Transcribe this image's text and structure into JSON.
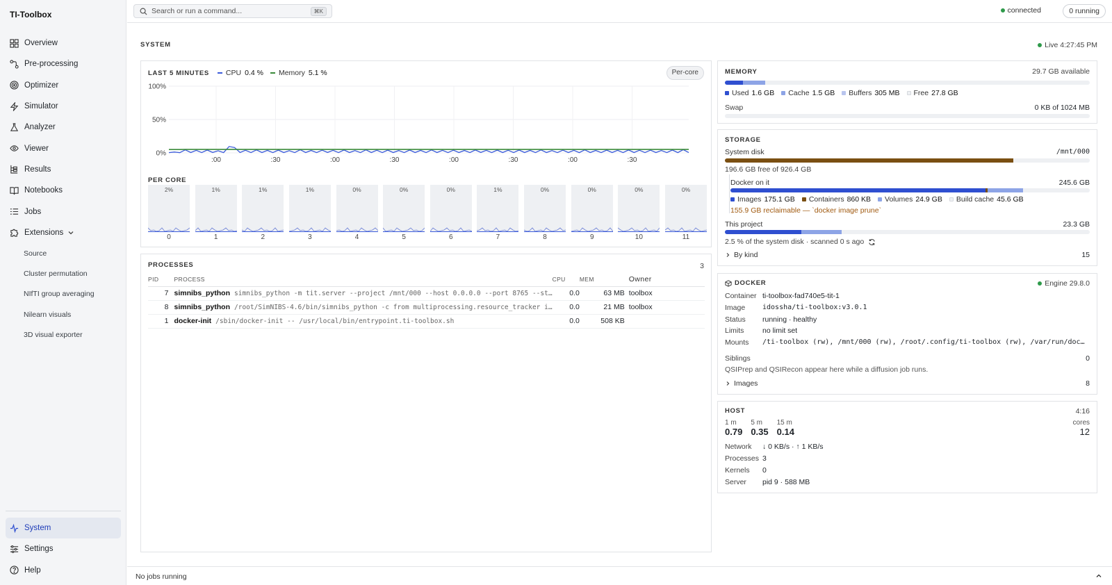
{
  "app": {
    "title": "TI-Toolbox"
  },
  "sidebar": {
    "items": [
      {
        "label": "Overview",
        "icon": "grid-icon"
      },
      {
        "label": "Pre-processing",
        "icon": "workflow-icon"
      },
      {
        "label": "Optimizer",
        "icon": "target-icon"
      },
      {
        "label": "Simulator",
        "icon": "bolt-icon"
      },
      {
        "label": "Analyzer",
        "icon": "flask-icon"
      },
      {
        "label": "Viewer",
        "icon": "eye-icon"
      },
      {
        "label": "Results",
        "icon": "tree-icon"
      },
      {
        "label": "Notebooks",
        "icon": "book-icon"
      },
      {
        "label": "Jobs",
        "icon": "list-icon"
      },
      {
        "label": "Extensions",
        "icon": "puzzle-icon"
      }
    ],
    "extensions": [
      "Source",
      "Cluster permutation",
      "NIfTI group averaging",
      "Nilearn visuals",
      "3D visual exporter"
    ],
    "bottom": [
      {
        "label": "System",
        "icon": "activity-icon",
        "active": true
      },
      {
        "label": "Settings",
        "icon": "sliders-icon"
      },
      {
        "label": "Help",
        "icon": "help-icon"
      }
    ]
  },
  "topbar": {
    "search_placeholder": "Search or run a command...",
    "shortcut": "⌘K",
    "connection": "connected",
    "running": "0 running"
  },
  "main": {
    "section": "SYSTEM",
    "live": "Live 4:27:45 PM"
  },
  "chart": {
    "title": "LAST 5 MINUTES",
    "cpu_label": "CPU",
    "cpu_value": "0.4 %",
    "mem_label": "Memory",
    "mem_value": "5.1 %",
    "percore_button": "Per-core",
    "percore_title": "PER CORE"
  },
  "chart_data": {
    "type": "line",
    "y_ticks": [
      "100%",
      "50%",
      "0%"
    ],
    "x_ticks": [
      ":00",
      ":30",
      ":00",
      ":30",
      ":00",
      ":30",
      ":00",
      ":30"
    ],
    "ylim": [
      0,
      100
    ],
    "series": [
      {
        "name": "CPU",
        "color": "#3b5bdb",
        "values": [
          0.4,
          1.2,
          0.3,
          4.5,
          0.5,
          3.8,
          0.4,
          4.2,
          0.6,
          3.1,
          0.4,
          9.5,
          8.0,
          0.5,
          3.9,
          0.4,
          4.4,
          0.5,
          3.6,
          0.4,
          4.1,
          0.5,
          3.2,
          0.4,
          4.6,
          0.5,
          3.5,
          0.4,
          4.0,
          0.6,
          3.7,
          0.4,
          4.3,
          0.5,
          3.3,
          0.4,
          4.5,
          0.5,
          3.9,
          0.4,
          4.1,
          0.5,
          3.4,
          0.4,
          4.2,
          0.5,
          3.6,
          0.4,
          4.4,
          0.5,
          3.8,
          0.4,
          4.0,
          0.5,
          3.5,
          0.4,
          4.3,
          0.6,
          3.7,
          0.4,
          4.1,
          0.5,
          3.9,
          0.4,
          4.2,
          0.5,
          3.6,
          0.4,
          4.4,
          0.5,
          3.3,
          0.4,
          4.0,
          0.5,
          3.8,
          0.4,
          4.5,
          0.5,
          3.5,
          0.4,
          4.1,
          0.5,
          3.7,
          0.4,
          4.3,
          0.5,
          3.9,
          0.4,
          4.0,
          0.5,
          3.4,
          0.4,
          4.2,
          0.4,
          4.8,
          0.4
        ]
      },
      {
        "name": "Memory",
        "color": "#3a8a3a",
        "values": [
          5.0,
          5.0,
          5.0,
          5.1,
          5.1,
          5.1,
          5.1,
          5.1,
          5.1,
          5.1,
          5.1,
          5.1,
          5.1,
          5.1,
          5.1,
          5.1,
          5.1,
          5.1,
          5.1,
          5.1,
          5.1,
          5.1,
          5.1,
          5.1,
          5.1,
          5.1,
          5.1,
          5.1,
          5.1,
          5.1,
          5.1,
          5.1,
          5.1,
          5.1,
          5.1,
          5.1,
          5.1,
          5.1,
          5.1,
          5.1,
          5.1,
          5.1,
          5.1,
          5.1,
          5.1,
          5.1,
          5.1,
          5.1,
          5.1,
          5.1,
          5.1,
          5.1,
          5.1,
          5.1,
          5.1,
          5.1,
          5.1,
          5.1,
          5.1,
          5.1,
          5.1,
          5.1,
          5.1,
          5.1,
          5.1,
          5.1,
          5.1,
          5.1,
          5.1,
          5.1,
          5.1,
          5.1,
          5.1,
          5.1,
          5.1,
          5.1,
          5.1,
          5.1,
          5.1,
          5.1,
          5.1,
          5.1,
          5.1,
          5.1,
          5.1,
          5.1,
          5.1,
          5.1,
          5.1,
          5.1,
          5.1,
          5.1,
          5.1,
          5.1,
          5.1,
          5.1
        ]
      }
    ],
    "cores": [
      {
        "label": "0",
        "pct": "2%"
      },
      {
        "label": "1",
        "pct": "1%"
      },
      {
        "label": "2",
        "pct": "1%"
      },
      {
        "label": "3",
        "pct": "1%"
      },
      {
        "label": "4",
        "pct": "0%"
      },
      {
        "label": "5",
        "pct": "0%"
      },
      {
        "label": "6",
        "pct": "0%"
      },
      {
        "label": "7",
        "pct": "1%"
      },
      {
        "label": "8",
        "pct": "0%"
      },
      {
        "label": "9",
        "pct": "0%"
      },
      {
        "label": "10",
        "pct": "0%"
      },
      {
        "label": "11",
        "pct": "0%"
      }
    ]
  },
  "processes": {
    "title": "PROCESSES",
    "count": "3",
    "headers": {
      "pid": "PID",
      "process": "PROCESS",
      "cpu": "CPU",
      "mem": "MEM",
      "owner": "Owner"
    },
    "rows": [
      {
        "pid": "7",
        "name": "simnibs_python",
        "cmd": "simnibs_python -m tit.server --project /mnt/000 --host 0.0.0.0 --port 8765 --st…",
        "cpu": "0.0",
        "mem": "63 MB",
        "owner": "toolbox"
      },
      {
        "pid": "8",
        "name": "simnibs_python",
        "cmd": "/root/SimNIBS-4.6/bin/simnibs_python -c from multiprocessing.resource_tracker i…",
        "cpu": "0.0",
        "mem": "21 MB",
        "owner": "toolbox"
      },
      {
        "pid": "1",
        "name": "docker-init",
        "cmd": "/sbin/docker-init -- /usr/local/bin/entrypoint.ti-toolbox.sh",
        "cpu": "0.0",
        "mem": "508 KB",
        "owner": ""
      }
    ]
  },
  "memory": {
    "title": "MEMORY",
    "available": "29.7 GB available",
    "used_frac": 0.05,
    "cache_frac": 0.05,
    "buffers_frac": 0.01,
    "legend": [
      {
        "label": "Used",
        "value": "1.6 GB",
        "color": "#2f4fd0"
      },
      {
        "label": "Cache",
        "value": "1.5 GB",
        "color": "#8da4e6"
      },
      {
        "label": "Buffers",
        "value": "305 MB",
        "color": "#b9c5ee"
      },
      {
        "label": "Free",
        "value": "27.8 GB",
        "color": "#eef0f3"
      }
    ],
    "swap_label": "Swap",
    "swap_value": "0 KB of 1024 MB"
  },
  "storage": {
    "title": "STORAGE",
    "system_disk_label": "System disk",
    "system_disk_path": "/mnt/000",
    "system_disk_used_frac": 0.79,
    "system_disk_free": "196.6 GB free of 926.4 GB",
    "docker_label": "Docker on it",
    "docker_total": "245.6 GB",
    "docker_images_frac": 0.71,
    "docker_containers_frac": 0.005,
    "docker_buildcache_frac": 0.1,
    "docker_legend": [
      {
        "label": "Images",
        "value": "175.1 GB",
        "color": "#2f4fd0"
      },
      {
        "label": "Containers",
        "value": "860 KB",
        "color": "#7a4f12"
      },
      {
        "label": "Volumes",
        "value": "24.9 GB",
        "color": "#8da4e6"
      },
      {
        "label": "Build cache",
        "value": "45.6 GB",
        "color": "#eef0f3"
      }
    ],
    "reclaimable": "155.9 GB reclaimable — `docker image prune`",
    "project_label": "This project",
    "project_value": "23.3 GB",
    "project_frac_a": 0.21,
    "project_frac_b": 0.32,
    "project_note": "2.5 % of the system disk · scanned 0 s ago",
    "by_kind_label": "By kind",
    "by_kind_count": "15",
    "colors": {
      "disk": "#7a4f12",
      "images": "#2f4fd0",
      "buildcache": "#8da4e6"
    }
  },
  "docker": {
    "title": "DOCKER",
    "engine": "Engine 29.8.0",
    "fields": [
      {
        "key": "Container",
        "value": "ti-toolbox-fad740e5-tit-1",
        "mono": false
      },
      {
        "key": "Image",
        "value": "idossha/ti-toolbox:v3.0.1",
        "mono": true
      },
      {
        "key": "Status",
        "value": "running · healthy",
        "mono": false
      },
      {
        "key": "Limits",
        "value": "no limit set",
        "mono": false
      },
      {
        "key": "Mounts",
        "value": "/ti-toolbox (rw), /mnt/000 (rw), /root/.config/ti-toolbox (rw), /var/run/doc…",
        "mono": true
      }
    ],
    "siblings_label": "Siblings",
    "siblings_count": "0",
    "siblings_note": "QSIPrep and QSIRecon appear here while a diffusion job runs.",
    "images_label": "Images",
    "images_count": "8"
  },
  "host": {
    "title": "HOST",
    "uptime": "4:16",
    "loads": [
      {
        "label": "1 m",
        "value": "0.79"
      },
      {
        "label": "5 m",
        "value": "0.35"
      },
      {
        "label": "15 m",
        "value": "0.14"
      }
    ],
    "cores_label": "cores",
    "cores_value": "12",
    "fields": [
      {
        "key": "Network",
        "value": "↓ 0 KB/s · ↑ 1 KB/s"
      },
      {
        "key": "Processes",
        "value": "3"
      },
      {
        "key": "Kernels",
        "value": "0"
      },
      {
        "key": "Server",
        "value": "pid 9 · 588 MB"
      }
    ]
  },
  "statusbar": {
    "text": "No jobs running"
  }
}
